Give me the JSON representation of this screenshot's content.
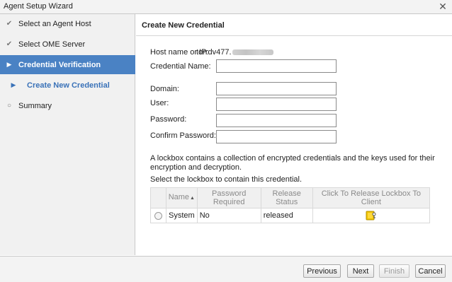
{
  "window": {
    "title": "Agent Setup Wizard",
    "close_glyph": "✕"
  },
  "steps": [
    {
      "label": "Select an Agent Host",
      "mark": "✔",
      "state": "done"
    },
    {
      "label": "Select OME Server",
      "mark": "✔",
      "state": "done"
    },
    {
      "label": "Credential Verification",
      "mark": "▶",
      "state": "active"
    },
    {
      "label": "Create New Credential",
      "mark": "▶",
      "state": "sub"
    },
    {
      "label": "Summary",
      "mark": "○",
      "state": "pending"
    }
  ],
  "main": {
    "header": "Create New Credential",
    "host_label": "Host name or IP:",
    "host_value": "torrdv477.",
    "fields": {
      "credential_name": {
        "label": "Credential Name:",
        "value": ""
      },
      "domain": {
        "label": "Domain:",
        "value": ""
      },
      "user": {
        "label": "User:",
        "value": ""
      },
      "password": {
        "label": "Password:",
        "value": ""
      },
      "confirm_password": {
        "label": "Confirm Password:",
        "value": ""
      }
    },
    "lockbox_description": "A lockbox contains a collection of encrypted credentials and the keys used for their encryption and decryption.",
    "lockbox_prompt": "Select the lockbox to contain this credential.",
    "table": {
      "columns": [
        "",
        "Name",
        "Password Required",
        "Release Status",
        "Click To Release Lockbox To Client"
      ],
      "sort_glyph": "▲",
      "rows": [
        {
          "name": "System",
          "password_required": "No",
          "release_status": "released",
          "action_icon": "lockbox-release-icon"
        }
      ]
    }
  },
  "buttons": {
    "previous": "Previous",
    "next": "Next",
    "finish": "Finish",
    "cancel": "Cancel"
  },
  "colors": {
    "accent": "#4a82c4",
    "sub_step": "#3a72b8",
    "lock_icon": "#f2c500"
  }
}
